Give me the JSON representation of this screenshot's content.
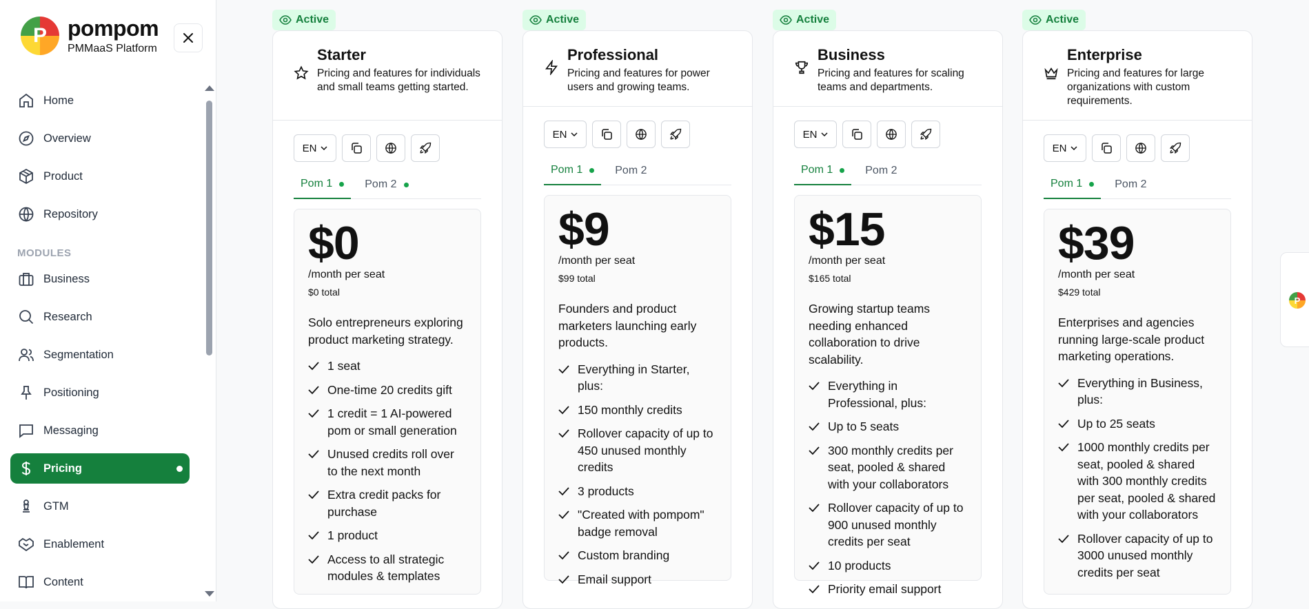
{
  "brand": {
    "name": "pompom",
    "subtitle": "PMMaaS Platform",
    "logo_letter": "P"
  },
  "nav": {
    "top": [
      {
        "label": "Home",
        "icon": "home-icon"
      },
      {
        "label": "Overview",
        "icon": "compass-icon"
      },
      {
        "label": "Product",
        "icon": "box-icon"
      },
      {
        "label": "Repository",
        "icon": "globe-icon"
      }
    ],
    "modules_label": "MODULES",
    "modules": [
      {
        "label": "Business",
        "icon": "briefcase-icon"
      },
      {
        "label": "Research",
        "icon": "search-icon"
      },
      {
        "label": "Segmentation",
        "icon": "users-icon"
      },
      {
        "label": "Positioning",
        "icon": "pin-icon"
      },
      {
        "label": "Messaging",
        "icon": "message-icon"
      },
      {
        "label": "Pricing",
        "icon": "dollar-icon",
        "active": true
      },
      {
        "label": "GTM",
        "icon": "chess-icon"
      },
      {
        "label": "Enablement",
        "icon": "handshake-icon"
      },
      {
        "label": "Content",
        "icon": "book-icon"
      }
    ]
  },
  "colors": {
    "accent": "#15803d",
    "badge_bg": "#dcfce7"
  },
  "plans": [
    {
      "badge": "Active",
      "name": "Starter",
      "icon": "star-icon",
      "description": "Pricing and features for individuals and small teams getting started.",
      "lang": "EN",
      "tabs": [
        {
          "label": "Pom 1",
          "dot": true,
          "active": true
        },
        {
          "label": "Pom 2",
          "dot": true,
          "active": false
        }
      ],
      "price": "$0",
      "per": "/month per seat",
      "total": "$0 total",
      "summary": "Solo entrepreneurs exploring product marketing strategy.",
      "features": [
        "1 seat",
        "One-time 20 credits gift",
        "1 credit = 1 AI-powered pom or small generation",
        "Unused credits roll over to the next month",
        "Extra credit packs for purchase",
        "1 product",
        "Access to all strategic modules & templates"
      ]
    },
    {
      "badge": "Active",
      "name": "Professional",
      "icon": "zap-icon",
      "description": "Pricing and features for power users and growing teams.",
      "lang": "EN",
      "tabs": [
        {
          "label": "Pom 1",
          "dot": true,
          "active": true
        },
        {
          "label": "Pom 2",
          "dot": false,
          "active": false
        }
      ],
      "price": "$9",
      "per": "/month per seat",
      "total": "$99 total",
      "summary": "Founders and product marketers launching early products.",
      "features": [
        "Everything in Starter, plus:",
        "150 monthly credits",
        "Rollover capacity of up to 450 unused monthly credits",
        "3 products",
        "\"Created with pompom\" badge removal",
        "Custom branding",
        "Email support"
      ]
    },
    {
      "badge": "Active",
      "name": "Business",
      "icon": "trophy-icon",
      "description": "Pricing and features for scaling teams and departments.",
      "lang": "EN",
      "tabs": [
        {
          "label": "Pom 1",
          "dot": true,
          "active": true
        },
        {
          "label": "Pom 2",
          "dot": false,
          "active": false
        }
      ],
      "price": "$15",
      "per": "/month per seat",
      "total": "$165 total",
      "summary": "Growing startup teams needing enhanced collaboration to drive scalability.",
      "features": [
        "Everything in Professional, plus:",
        "Up to 5 seats",
        "300 monthly credits per seat, pooled & shared with your collaborators",
        "Rollover capacity of up to 900 unused monthly credits per seat",
        "10 products",
        "Priority email support"
      ]
    },
    {
      "badge": "Active",
      "name": "Enterprise",
      "icon": "crown-icon",
      "description": "Pricing and features for large organizations with custom requirements.",
      "lang": "EN",
      "tabs": [
        {
          "label": "Pom 1",
          "dot": true,
          "active": true
        },
        {
          "label": "Pom 2",
          "dot": false,
          "active": false
        }
      ],
      "price": "$39",
      "per": "/month per seat",
      "total": "$429 total",
      "summary": "Enterprises and agencies running large-scale product marketing operations.",
      "features": [
        "Everything in Business, plus:",
        "Up to 25 seats",
        "1000 monthly credits per seat, pooled & shared with 300 monthly credits per seat, pooled & shared with your collaborators",
        "Rollover capacity of up to 3000 unused monthly credits per seat"
      ]
    }
  ]
}
